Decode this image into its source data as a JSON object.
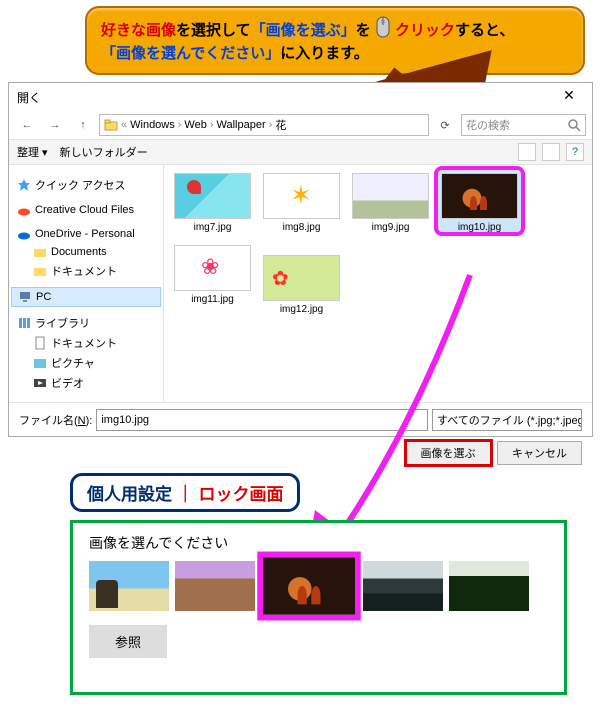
{
  "callout": {
    "p1": "好きな画像",
    "p2": "を選択して",
    "p3": "「画像を選ぶ」",
    "p4": "を",
    "p5": "クリック",
    "p6": "すると、",
    "p7": "「画像を選んでください」",
    "p8": "に入ります。"
  },
  "dialog": {
    "title": "開く",
    "close": "✕",
    "nav": {
      "back": "←",
      "fwd": "→",
      "up": "↑",
      "refresh": "⟳"
    },
    "breadcrumb": [
      "«",
      "Windows",
      "Web",
      "Wallpaper",
      "花"
    ],
    "search_placeholder": "花の検索",
    "toolbar": {
      "organize": "整理 ▾",
      "new_folder": "新しいフォルダー",
      "help": "?"
    },
    "sidebar": {
      "quick_access": "クイック アクセス",
      "creative_cloud": "Creative Cloud Files",
      "onedrive": "OneDrive - Personal",
      "documents": "Documents",
      "documents_jp": "ドキュメント",
      "pc": "PC",
      "library": "ライブラリ",
      "lib_documents": "ドキュメント",
      "lib_pictures": "ピクチャ",
      "lib_videos": "ビデオ"
    },
    "files": [
      {
        "name": "img7.jpg",
        "thumb": "th1",
        "selected": false
      },
      {
        "name": "img8.jpg",
        "thumb": "th2",
        "selected": false
      },
      {
        "name": "img9.jpg",
        "thumb": "th3",
        "selected": false
      },
      {
        "name": "img10.jpg",
        "thumb": "th4",
        "selected": true
      },
      {
        "name": "img11.jpg",
        "thumb": "th5",
        "selected": false
      },
      {
        "name": "img12.jpg",
        "thumb": "th6",
        "selected": false
      }
    ],
    "filename_label_pre": "ファイル名(",
    "filename_label_u": "N",
    "filename_label_post": "):",
    "filename_value": "img10.jpg",
    "filter_value": "すべてのファイル (*.jpg;*.jpeg;*.bmp",
    "filter_chev": "⌄",
    "open_btn": "画像を選ぶ",
    "cancel_btn": "キャンセル"
  },
  "settings_label": {
    "a": "個人用設定",
    "sep": "｜",
    "c": "ロック画面"
  },
  "settings_panel": {
    "title": "画像を選んでください",
    "browse": "参照"
  }
}
